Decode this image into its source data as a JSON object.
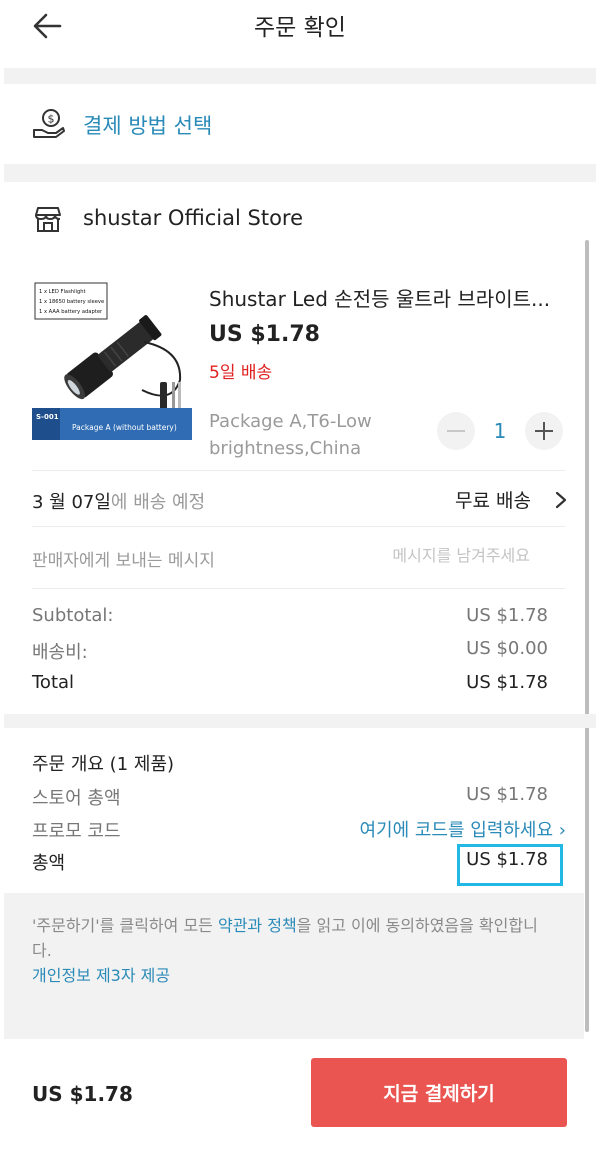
{
  "header": {
    "title": "주문 확인"
  },
  "payment": {
    "label": "결제 방법 선택"
  },
  "store": {
    "name": "shustar Official Store"
  },
  "product": {
    "title": "Shustar Led 손전등 울트라 브라이트...",
    "price": "US $1.78",
    "delivery_days": "5일 배송",
    "variant": "Package A,T6-Low brightness,China",
    "quantity": "1",
    "image_labels": {
      "contents": [
        "1 x LED Flashlight",
        "1 x 18650 battery sleeve",
        "1 x AAA battery adapter"
      ],
      "model": "S-001",
      "package": "Package A (without battery)"
    }
  },
  "delivery": {
    "date_strong": "3 월 07일",
    "date_rest": "에 배송 예정",
    "shipping_option": "무료 배송"
  },
  "message": {
    "label": "판매자에게 보내는 메시지",
    "placeholder": "메시지를 남겨주세요"
  },
  "subtotals": {
    "subtotal_label": "Subtotal:",
    "subtotal_value": "US $1.78",
    "shipping_label": "배송비:",
    "shipping_value": "US $0.00",
    "total_label": "Total",
    "total_value": "US $1.78"
  },
  "summary": {
    "title": "주문 개요 (1 제품)",
    "store_total_label": "스토어 총액",
    "store_total_value": "US $1.78",
    "promo_label": "프로모 코드",
    "promo_link": "여기에 코드를 입력하세요",
    "grand_total_label": "총액",
    "grand_total_value": "US $1.78"
  },
  "terms": {
    "part1": "'주문하기'를 클릭하여 모든 ",
    "link": "약관과 정책",
    "part2": "을 읽고 이에 동의하였음을 확인합니다.",
    "privacy": "개인정보 제3자 제공"
  },
  "footer": {
    "total": "US $1.78",
    "pay_button": "지금 결제하기"
  },
  "colors": {
    "accent_blue": "#2a8ab8",
    "pay_red": "#ea5551",
    "delivery_red": "#e02020",
    "highlight": "#22b8e6"
  }
}
